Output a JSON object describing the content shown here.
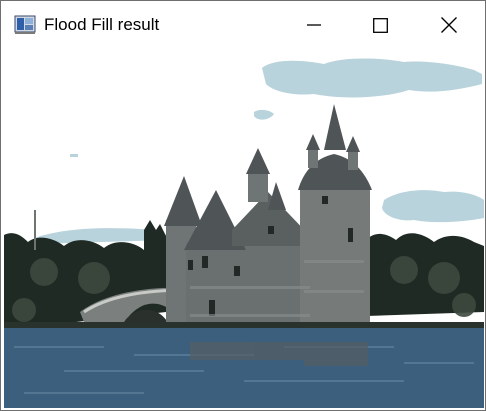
{
  "window": {
    "title": "Flood Fill result",
    "controls": {
      "minimize_icon": "minimize-icon",
      "maximize_icon": "maximize-icon",
      "close_icon": "close-icon"
    }
  },
  "colors": {
    "sky": "#ffffff",
    "cloud": "#b9d3dc",
    "stone": "#6f7474",
    "roof": "#4f5456",
    "trees": "#1f2a24",
    "water": "#3c5f7d"
  }
}
